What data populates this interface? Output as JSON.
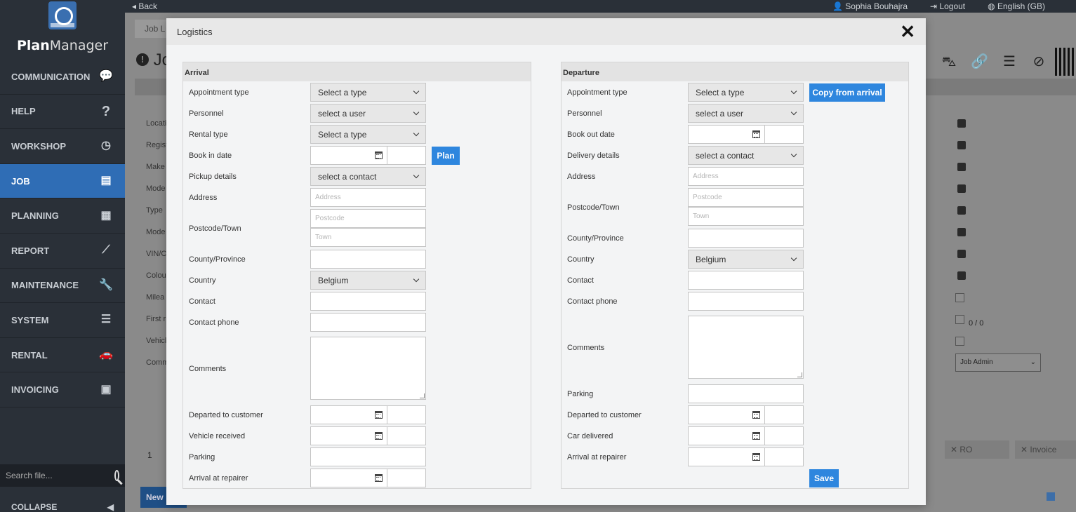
{
  "app": {
    "name_bold": "Plan",
    "name_rest": "Manager"
  },
  "topbar": {
    "back": "◂ Back",
    "user": "Sophia Bouhajra",
    "logout": "Logout",
    "language": "English (GB)"
  },
  "sidebar": {
    "items": [
      {
        "label": "COMMUNICATION",
        "icon": "chat-icon"
      },
      {
        "label": "HELP",
        "icon": "question-icon"
      },
      {
        "label": "WORKSHOP",
        "icon": "clock-icon"
      },
      {
        "label": "JOB",
        "icon": "document-icon"
      },
      {
        "label": "PLANNING",
        "icon": "calendar-icon"
      },
      {
        "label": "REPORT",
        "icon": "chart-icon"
      },
      {
        "label": "MAINTENANCE",
        "icon": "wrench-icon"
      },
      {
        "label": "SYSTEM",
        "icon": "sliders-icon"
      },
      {
        "label": "RENTAL",
        "icon": "car-icon"
      },
      {
        "label": "INVOICING",
        "icon": "money-icon"
      }
    ],
    "search_placeholder": "Search file...",
    "collapse": "COLLAPSE"
  },
  "background": {
    "tab": "Job L",
    "heading": "Jo",
    "labels": [
      "Locati",
      "Regist",
      "Make",
      "Mode",
      "Type",
      "Mode",
      "VIN/C",
      "Colou",
      "Milea",
      "First r",
      "Vehicl",
      "Comm"
    ],
    "counter": "0 / 0",
    "select_value": "Job Admin",
    "page_number": "1",
    "btn_ro": "✕ RO",
    "btn_invoice": "✕ Invoice",
    "btn_new": "New"
  },
  "modal": {
    "title": "Logistics",
    "arrival": {
      "title": "Arrival",
      "appointment_type": {
        "label": "Appointment type",
        "value": "Select a type"
      },
      "personnel": {
        "label": "Personnel",
        "value": "select a user"
      },
      "rental_type": {
        "label": "Rental type",
        "value": "Select a type"
      },
      "book_in_date": {
        "label": "Book in date"
      },
      "plan_button": "Plan",
      "pickup_details": {
        "label": "Pickup details",
        "value": "select a contact"
      },
      "address": {
        "label": "Address",
        "placeholder": "Address"
      },
      "postcode_town": {
        "label": "Postcode/Town",
        "postcode_placeholder": "Postcode",
        "town_placeholder": "Town"
      },
      "county": {
        "label": "County/Province"
      },
      "country": {
        "label": "Country",
        "value": "Belgium"
      },
      "contact": {
        "label": "Contact"
      },
      "contact_phone": {
        "label": "Contact phone"
      },
      "comments": {
        "label": "Comments"
      },
      "departed": {
        "label": "Departed to customer"
      },
      "vehicle_received": {
        "label": "Vehicle received"
      },
      "parking": {
        "label": "Parking"
      },
      "arrival_repairer": {
        "label": "Arrival at repairer"
      }
    },
    "departure": {
      "title": "Departure",
      "appointment_type": {
        "label": "Appointment type",
        "value": "Select a type"
      },
      "copy_button": "Copy from arrival",
      "personnel": {
        "label": "Personnel",
        "value": "select a user"
      },
      "book_out_date": {
        "label": "Book out date"
      },
      "delivery_details": {
        "label": "Delivery details",
        "value": "select a contact"
      },
      "address": {
        "label": "Address",
        "placeholder": "Address"
      },
      "postcode_town": {
        "label": "Postcode/Town",
        "postcode_placeholder": "Postcode",
        "town_placeholder": "Town"
      },
      "county": {
        "label": "County/Province"
      },
      "country": {
        "label": "Country",
        "value": "Belgium"
      },
      "contact": {
        "label": "Contact"
      },
      "contact_phone": {
        "label": "Contact phone"
      },
      "comments": {
        "label": "Comments"
      },
      "parking": {
        "label": "Parking"
      },
      "departed": {
        "label": "Departed to customer"
      },
      "car_delivered": {
        "label": "Car delivered"
      },
      "arrival_repairer": {
        "label": "Arrival at repairer"
      },
      "save_button": "Save"
    }
  }
}
